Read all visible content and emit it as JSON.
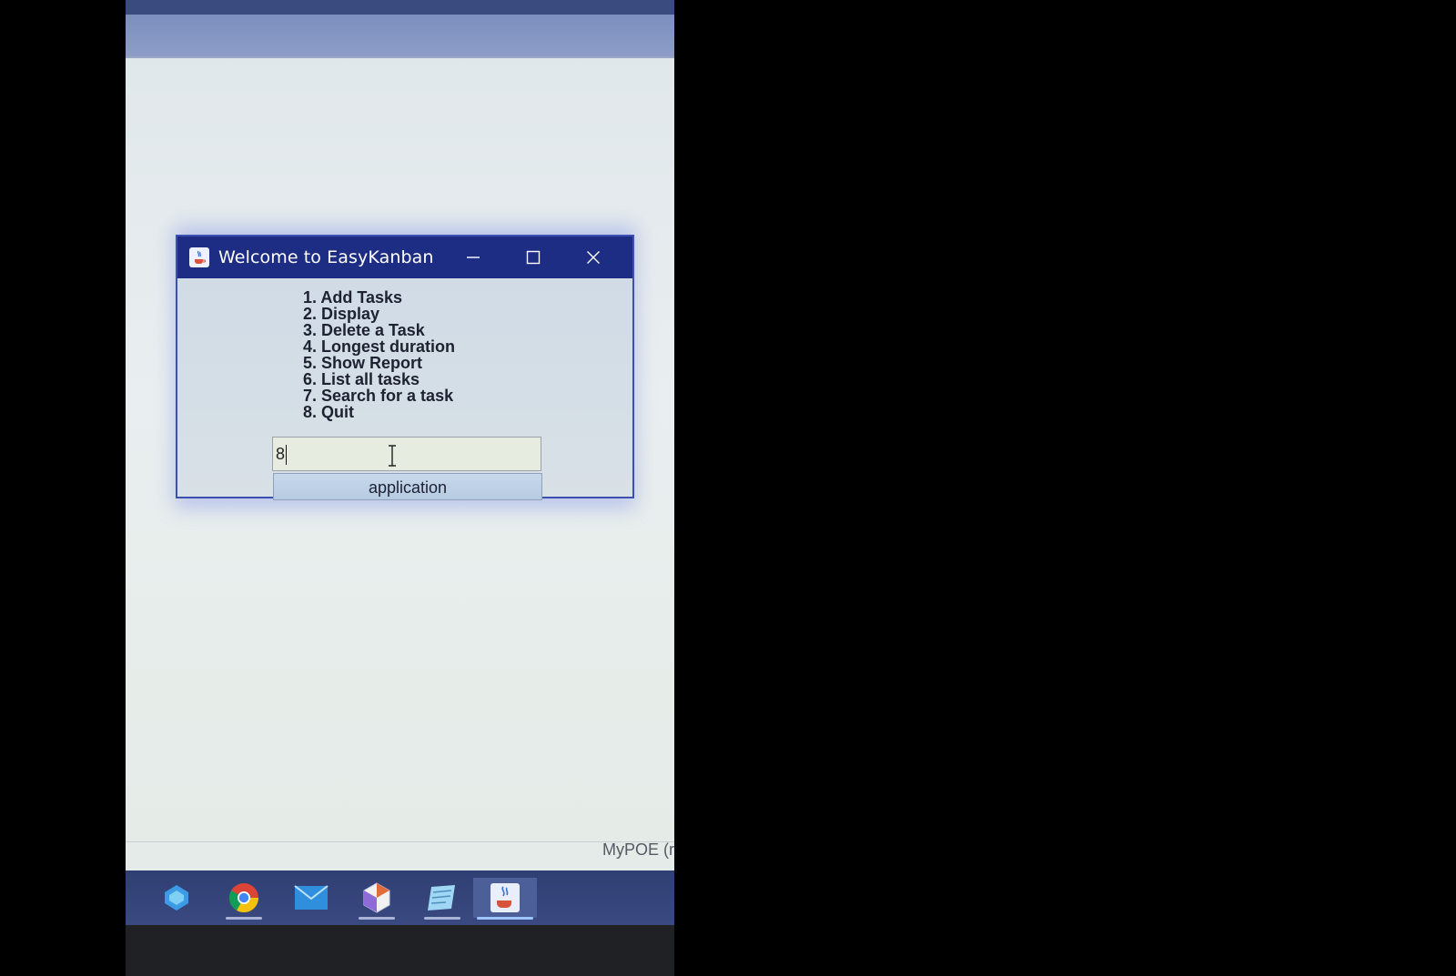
{
  "window": {
    "title": "Welcome to EasyKanban"
  },
  "menu": {
    "items": [
      "1. Add Tasks",
      "2. Display",
      "3. Delete a Task",
      "4. Longest duration",
      "5. Show Report",
      "6. List all tasks",
      "7. Search for a task",
      "8. Quit"
    ]
  },
  "input": {
    "value": "8"
  },
  "button": {
    "label": "application"
  },
  "status": {
    "text": "MyPOE (r"
  },
  "taskbar": {
    "icons": [
      "copilot-icon",
      "chrome-icon",
      "mail-icon",
      "office-icon",
      "notepad-icon",
      "java-app-icon"
    ]
  },
  "colors": {
    "titlebar": "#1e2d84",
    "taskbar": "#33437a",
    "window_border": "#3d4fb0"
  }
}
